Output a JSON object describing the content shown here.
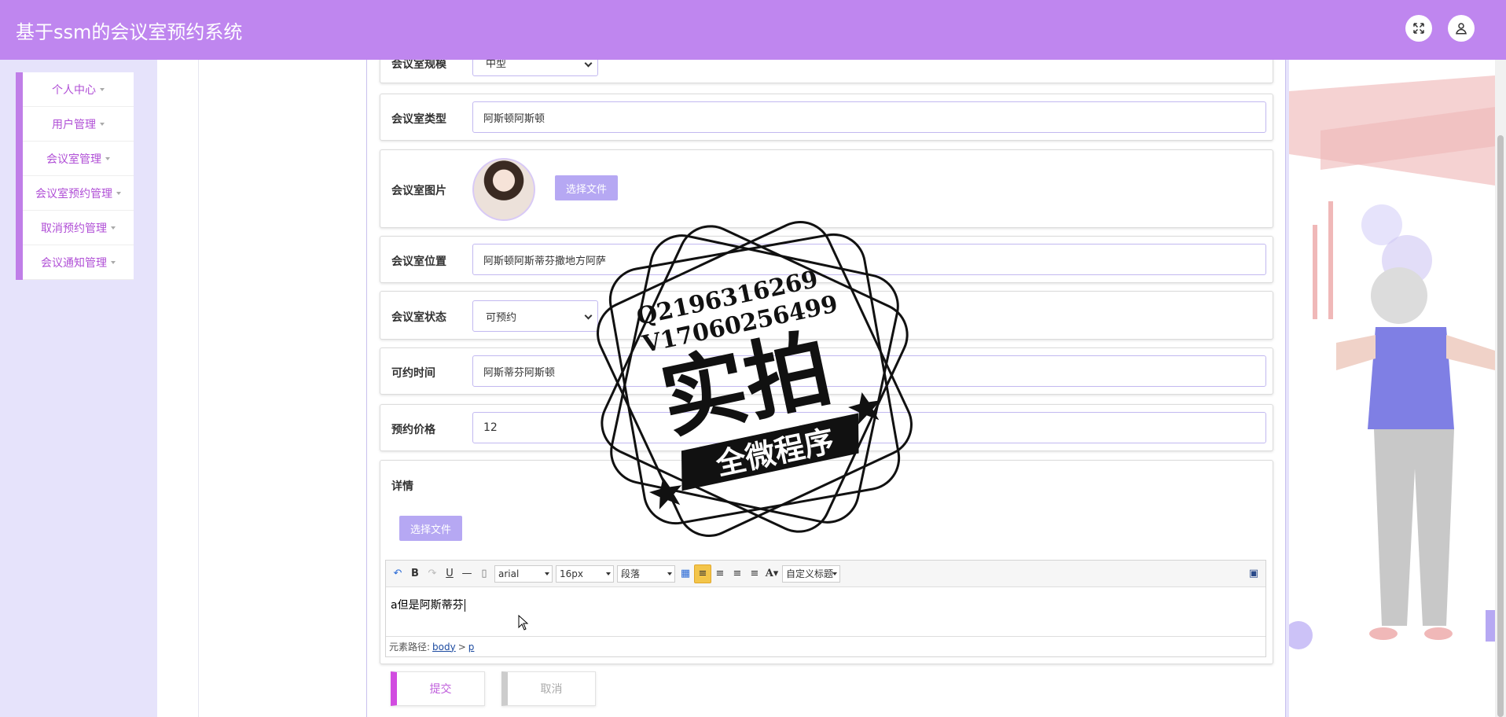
{
  "header": {
    "title": "基于ssm的会议室预约系统"
  },
  "sidebar": {
    "items": [
      {
        "label": "个人中心"
      },
      {
        "label": "用户管理"
      },
      {
        "label": "会议室管理"
      },
      {
        "label": "会议室预约管理"
      },
      {
        "label": "取消预约管理"
      },
      {
        "label": "会议通知管理"
      }
    ]
  },
  "form": {
    "scale": {
      "label": "会议室规模",
      "value": "中型"
    },
    "type": {
      "label": "会议室类型",
      "value": "阿斯顿阿斯顿"
    },
    "image": {
      "label": "会议室图片",
      "button": "选择文件"
    },
    "location": {
      "label": "会议室位置",
      "value": "阿斯顿阿斯蒂芬撒地方阿萨"
    },
    "status": {
      "label": "会议室状态",
      "value": "可预约"
    },
    "time": {
      "label": "可约时间",
      "value": "阿斯蒂芬阿斯顿"
    },
    "price": {
      "label": "预约价格",
      "value": "12"
    },
    "detail": {
      "label": "详情",
      "button": "选择文件",
      "toolbar": {
        "font": "arial",
        "size": "16px",
        "paragraph": "段落",
        "custom_title": "自定义标题"
      },
      "content": "a但是阿斯蒂芬",
      "path_label": "元素路径:",
      "path_body": "body",
      "path_sep": ">",
      "path_p": "p"
    },
    "submit": "提交",
    "cancel": "取消"
  },
  "watermark": {
    "line1": "Q2196316269",
    "line2": "V17060256499",
    "big": "实拍",
    "banner": "全微程序"
  },
  "colors": {
    "header": "#bf86ef",
    "accent": "#b04fd6",
    "file_button": "#b6a8f3"
  }
}
